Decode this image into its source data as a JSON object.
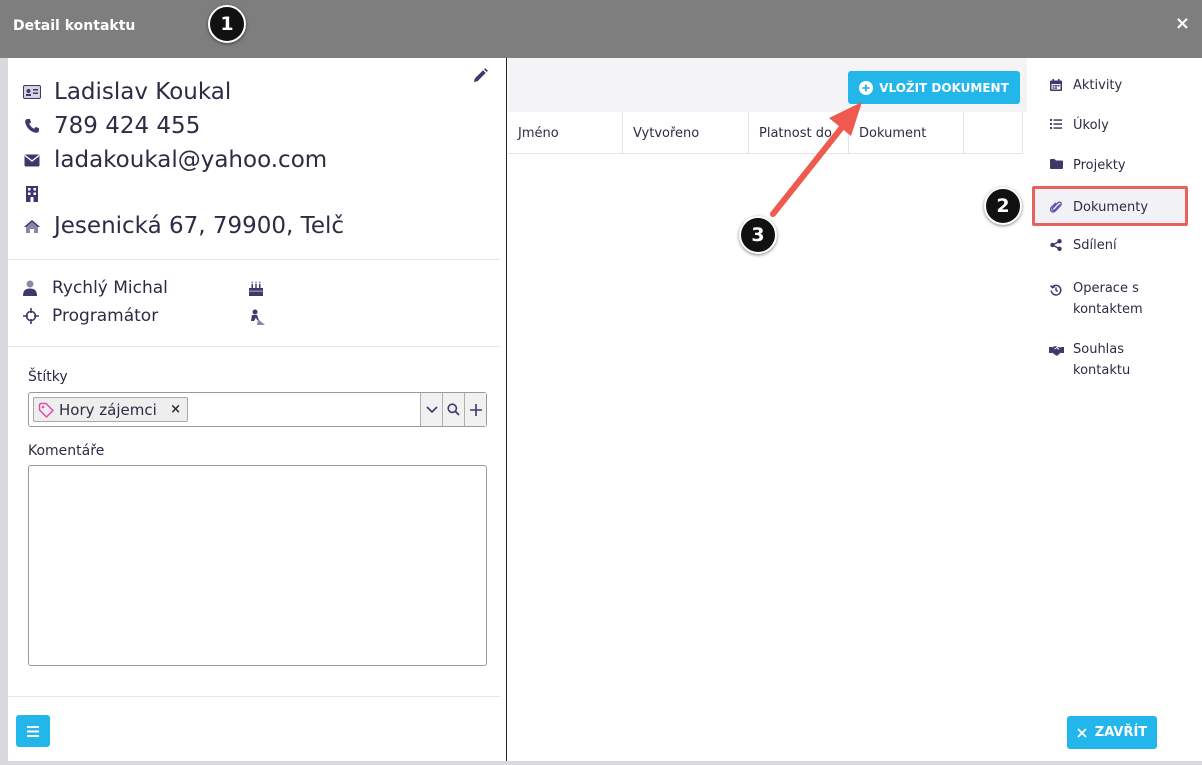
{
  "window": {
    "title": "Detail kontaktu",
    "close_symbol": "×"
  },
  "markers": [
    "1",
    "2",
    "3"
  ],
  "contact": {
    "name": "Ladislav Koukal",
    "phone": "789 424 455",
    "email": "ladakoukal@yahoo.com",
    "company": "",
    "address": "Jesenická 67, 79900, Telč",
    "owner": "Rychlý Michal",
    "position": "Programátor"
  },
  "tags": {
    "label": "Štítky",
    "items": [
      {
        "label": "Hory zájemci",
        "remove_symbol": "×"
      }
    ],
    "tag_color": "#e14bb7"
  },
  "comments": {
    "label": "Komentáře",
    "value": ""
  },
  "documents": {
    "insert_button": "VLOŽIT DOKUMENT",
    "columns": [
      "Jméno",
      "Vytvořeno",
      "Platnost do",
      "Dokument",
      ""
    ]
  },
  "nav": {
    "items": [
      {
        "label": "Aktivity",
        "icon": "calendar-icon"
      },
      {
        "label": "Úkoly",
        "icon": "list-icon"
      },
      {
        "label": "Projekty",
        "icon": "folder-icon"
      },
      {
        "label": "Dokumenty",
        "icon": "paperclip-icon",
        "active": true
      },
      {
        "label": "Sdílení",
        "icon": "share-icon"
      },
      {
        "label": "Operace s kontaktem",
        "icon": "history-icon"
      },
      {
        "label": "Souhlas kontaktu",
        "icon": "handshake-icon"
      }
    ],
    "close_button": "ZAVŘÍT"
  },
  "colors": {
    "accent": "#22b6ea",
    "highlight": "#e8615a",
    "titlebar": "#7e7e7e",
    "icon": "#3d3a6b"
  }
}
